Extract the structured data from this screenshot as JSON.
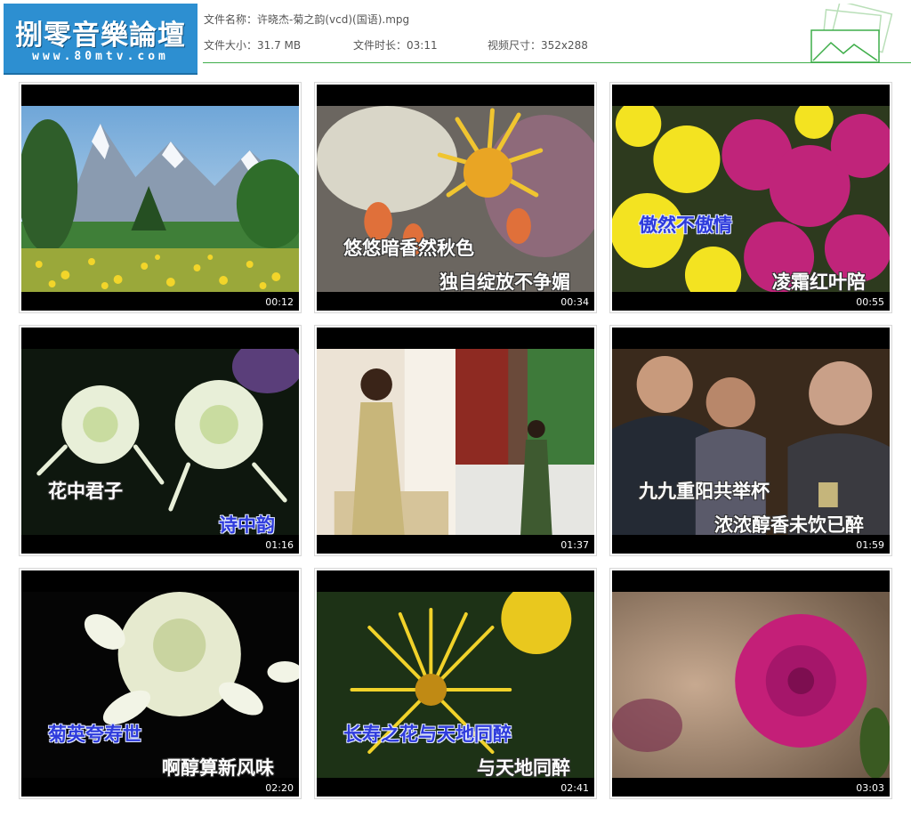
{
  "logo": {
    "title": "捌零音樂論壇",
    "url": "www.80mtv.com"
  },
  "file_info": {
    "name_label": "文件名称：",
    "name_value": "许晓杰-菊之韵(vcd)(国语).mpg",
    "size_label": "文件大小：",
    "size_value": "31.7 MB",
    "duration_label": "文件时长：",
    "duration_value": "03:11",
    "resolution_label": "视频尺寸：",
    "resolution_value": "352x288"
  },
  "thumbnails": [
    {
      "time": "00:12",
      "scene": "mountain-meadow"
    },
    {
      "time": "00:34",
      "scene": "yellow-chrysanthemum",
      "lyric1": "悠悠暗香然秋色",
      "lyric2": "独自绽放不争媚"
    },
    {
      "time": "00:55",
      "scene": "yellow-magenta-chrysanthemums",
      "lyric1": "傲然不傲情",
      "lyric2": "凌霜红叶陪"
    },
    {
      "time": "01:16",
      "scene": "white-chrysanthemums",
      "lyric1": "花中君子",
      "lyric2": "诗中韵"
    },
    {
      "time": "01:37",
      "scene": "singer-split-screen"
    },
    {
      "time": "01:59",
      "scene": "elderly-couple-toast",
      "lyric1": "九九重阳共举杯",
      "lyric2": "浓浓醇香未饮已醉"
    },
    {
      "time": "02:20",
      "scene": "white-chrysanthemum-closeup",
      "lyric1": "菊英夸寿世",
      "lyric2": "啊醇算新风味"
    },
    {
      "time": "02:41",
      "scene": "yellow-spider-chrysanthemum",
      "lyric1": "长寿之花与天地同醉",
      "lyric2": "与天地同醉"
    },
    {
      "time": "03:03",
      "scene": "magenta-chrysanthemum"
    }
  ],
  "colors": {
    "logo_bg": "#2d8fd1",
    "rule": "#3fae4a",
    "lyric_highlight": "#2e3bdc"
  }
}
